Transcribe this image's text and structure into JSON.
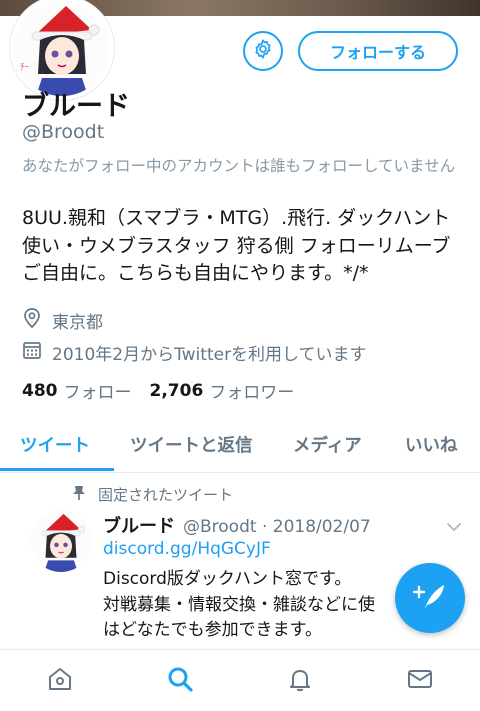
{
  "profile": {
    "name": "ブルード",
    "handle": "@Broodt",
    "follow_status": "あなたがフォロー中のアカウントは誰もフォローしていません",
    "bio": [
      "8UU.親和（スマブラ・MTG）.飛行. ダックハント",
      "使い・ウメブラスタッフ 狩る側 フォローリムーブ",
      "ご自由に。こちらも自由にやります。*/*"
    ],
    "location": "東京都",
    "joined": "2010年2月からTwitterを利用しています",
    "following_count": "480",
    "following_label": "フォロー",
    "followers_count": "2,706",
    "followers_label": "フォロワー"
  },
  "buttons": {
    "follow_label": "フォローする"
  },
  "tabs": [
    {
      "label": "ツイート",
      "active": true
    },
    {
      "label": "ツイートと返信",
      "active": false
    },
    {
      "label": "メディア",
      "active": false
    },
    {
      "label": "いいね",
      "active": false
    }
  ],
  "pinned_tweet": {
    "pinned_label": "固定されたツイート",
    "author_name": "ブルード",
    "author_meta": "@Broodt · 2018/02/07",
    "link": "discord.gg/HqGCyJF",
    "text_lines": [
      "Discord版ダックハント窓です。",
      "対戦募集・情報交換・雑談などに使",
      "はどなたでも参加できます。"
    ]
  },
  "icons": {
    "settings": "gear-icon",
    "location": "location-pin-icon",
    "calendar": "calendar-icon",
    "pin": "pin-icon",
    "more": "chevron-down-icon",
    "compose": "compose-tweet-icon",
    "nav": [
      "home-icon",
      "search-icon",
      "notifications-icon",
      "messages-icon"
    ]
  },
  "colors": {
    "accent": "#1da1f2",
    "secondary_text": "#657786",
    "primary_text": "#14171a"
  }
}
